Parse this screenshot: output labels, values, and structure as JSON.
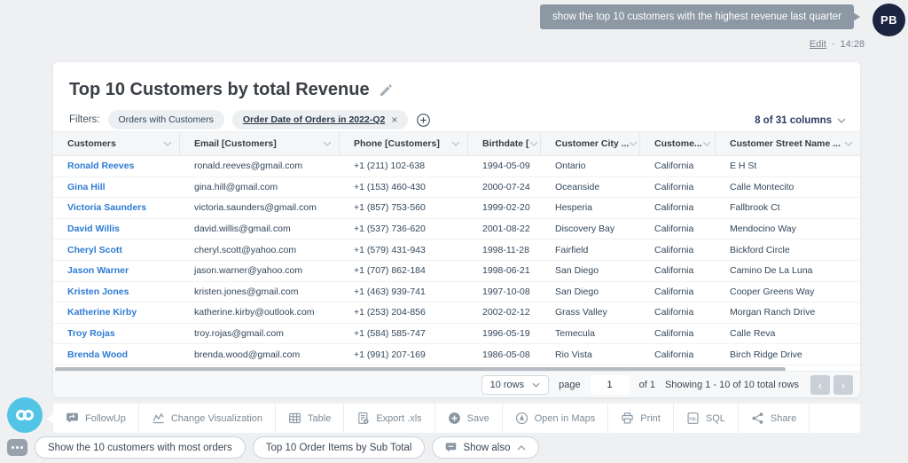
{
  "chat": {
    "message": "show the top 10 customers with the highest revenue last quarter",
    "avatar_initials": "PB",
    "edit_label": "Edit",
    "separator": "·",
    "timestamp": "14:28"
  },
  "report": {
    "title": "Top 10 Customers by total Revenue",
    "filters_label": "Filters:",
    "filters": [
      {
        "label": "Orders with Customers",
        "removable": false
      },
      {
        "label": "Order Date of Orders in 2022-Q2",
        "removable": true,
        "remove_icon": "×"
      }
    ],
    "columns_selector_label": "8 of 31 columns",
    "table": {
      "columns": [
        {
          "label": "Customers"
        },
        {
          "label": "Email [Customers]"
        },
        {
          "label": "Phone [Customers]"
        },
        {
          "label": "Birthdate ["
        },
        {
          "label": "Customer City ..."
        },
        {
          "label": "Custome..."
        },
        {
          "label": "Customer Street Name ..."
        }
      ],
      "rows": [
        [
          "Ronald Reeves",
          "ronald.reeves@gmail.com",
          "+1 (211) 102-638",
          "1994-05-09",
          "Ontario",
          "California",
          "E H St"
        ],
        [
          "Gina Hill",
          "gina.hill@gmail.com",
          "+1 (153) 460-430",
          "2000-07-24",
          "Oceanside",
          "California",
          "Calle Montecito"
        ],
        [
          "Victoria Saunders",
          "victoria.saunders@gmail.com",
          "+1 (857) 753-560",
          "1999-02-20",
          "Hesperia",
          "California",
          "Fallbrook Ct"
        ],
        [
          "David Willis",
          "david.willis@gmail.com",
          "+1 (537) 736-620",
          "2001-08-22",
          "Discovery Bay",
          "California",
          "Mendocino Way"
        ],
        [
          "Cheryl Scott",
          "cheryl.scott@yahoo.com",
          "+1 (579) 431-943",
          "1998-11-28",
          "Fairfield",
          "California",
          "Bickford Circle"
        ],
        [
          "Jason Warner",
          "jason.warner@yahoo.com",
          "+1 (707) 862-184",
          "1998-06-21",
          "San Diego",
          "California",
          "Camino De La Luna"
        ],
        [
          "Kristen Jones",
          "kristen.jones@gmail.com",
          "+1 (463) 939-741",
          "1997-10-08",
          "San Diego",
          "California",
          "Cooper Greens Way"
        ],
        [
          "Katherine Kirby",
          "katherine.kirby@outlook.com",
          "+1 (253) 204-856",
          "2002-02-12",
          "Grass Valley",
          "California",
          "Morgan Ranch Drive"
        ],
        [
          "Troy Rojas",
          "troy.rojas@gmail.com",
          "+1 (584) 585-747",
          "1996-05-19",
          "Temecula",
          "California",
          "Calle Reva"
        ],
        [
          "Brenda Wood",
          "brenda.wood@gmail.com",
          "+1 (991) 207-169",
          "1986-05-08",
          "Rio Vista",
          "California",
          "Birch Ridge Drive"
        ]
      ]
    },
    "pagination": {
      "rows_per_page": "10 rows",
      "page_label": "page",
      "page_value": "1",
      "of_label": "of 1",
      "summary": "Showing 1 - 10 of 10 total rows",
      "prev_icon": "‹",
      "next_icon": "›"
    }
  },
  "toolbar": {
    "items": [
      {
        "name": "followup-button",
        "icon": "followup-icon",
        "label": "FollowUp"
      },
      {
        "name": "change-visualization-button",
        "icon": "chart-line-icon",
        "label": "Change Visualization"
      },
      {
        "name": "table-button",
        "icon": "table-icon",
        "label": "Table"
      },
      {
        "name": "export-xls-button",
        "icon": "export-icon",
        "label": "Export .xls"
      },
      {
        "name": "save-button",
        "icon": "plus-circle-icon",
        "label": "Save"
      },
      {
        "name": "open-in-maps-button",
        "icon": "compass-icon",
        "label": "Open in Maps"
      },
      {
        "name": "print-button",
        "icon": "printer-icon",
        "label": "Print"
      },
      {
        "name": "sql-button",
        "icon": "sql-icon",
        "label": "SQL"
      },
      {
        "name": "share-button",
        "icon": "share-icon",
        "label": "Share"
      }
    ]
  },
  "suggestions": {
    "chips": [
      {
        "label": "Show the 10 customers with most orders"
      },
      {
        "label": "Top 10 Order Items by Sub Total"
      }
    ],
    "show_also": {
      "label": "Show also"
    }
  },
  "colors": {
    "accent_link": "#2e7bd3",
    "bubble_gray": "#8c98a4",
    "avatar_navy": "#1b2542",
    "bot_teal": "#52c5e6",
    "columns_selector_navy": "#2d3e66"
  }
}
